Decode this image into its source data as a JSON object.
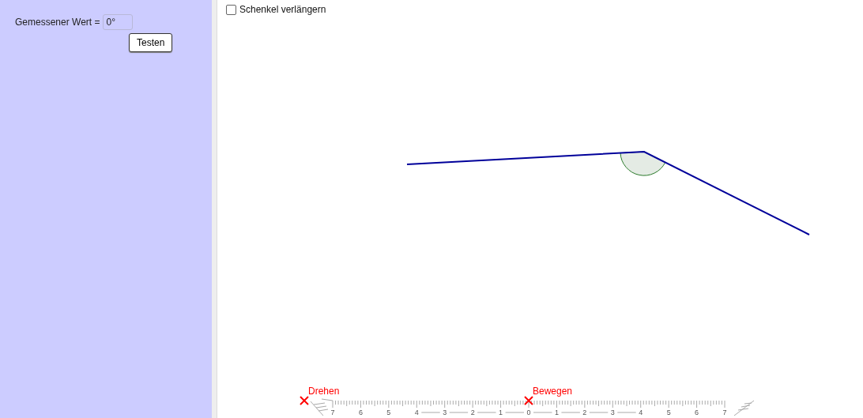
{
  "panel": {
    "label": "Gemessener Wert =",
    "input_value": "0°",
    "button": "Testen"
  },
  "checkbox": {
    "label": "Schenkel verlängern",
    "checked": false
  },
  "markers": [
    {
      "label": "Drehen"
    },
    {
      "label": "Bewegen"
    }
  ],
  "ruler": {
    "labels": [
      "7",
      "6",
      "5",
      "4",
      "3",
      "2",
      "1",
      "0",
      "1",
      "2",
      "3",
      "4",
      "5",
      "6",
      "7"
    ]
  }
}
